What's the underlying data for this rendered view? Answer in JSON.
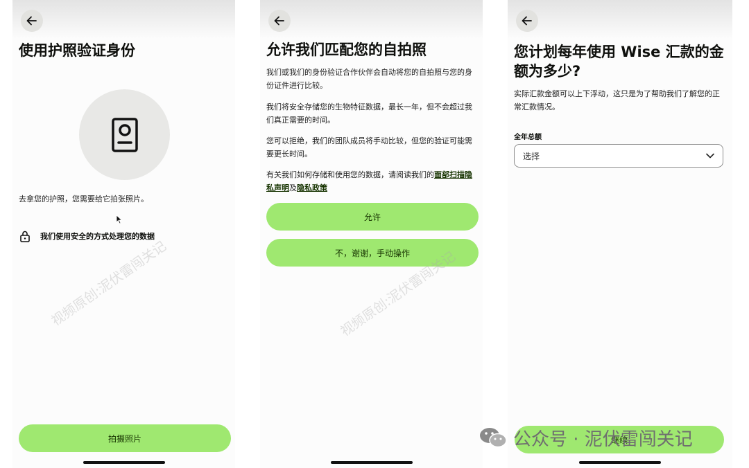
{
  "screen1": {
    "title": "使用护照验证身份",
    "instruction": "去拿您的护照，您需要给它拍张照片。",
    "security_note": "我们使用安全的方式处理您的数据",
    "take_photo_button": "拍摄照片"
  },
  "screen2": {
    "title": "允许我们匹配您的自拍照",
    "para1": "我们或我们的身份验证合作伙伴会自动将您的自拍照与您的身份证件进行比较。",
    "para2": "我们将安全存储您的生物特征数据，最长一年，但不会超过我们真正需要的时间。",
    "para3": "您可以拒绝，我们的团队成员将手动比较，但您的验证可能需要更长时间。",
    "para4_prefix": "有关我们如何存储和使用您的数据，请阅读我们的",
    "link_face_scan": "面部扫描隐私声明",
    "para4_and": "及",
    "link_privacy": "隐私政策",
    "allow_button": "允许",
    "decline_button": "不，谢谢，手动操作"
  },
  "screen3": {
    "title": "您计划每年使用 Wise 汇款的金额为多少?",
    "description": "实际汇款金额可以上下浮动，这只是为了帮助我们了解您的正常汇款情况。",
    "field_label": "全年总额",
    "select_placeholder": "选择",
    "continue_button": "继续"
  },
  "watermarks": {
    "diagonal": "视频原创:泥伏雷闯关记",
    "footer": "公众号 · 泥伏雷闯关记"
  },
  "colors": {
    "accent_green": "#9fe870",
    "button_text": "#163300"
  }
}
